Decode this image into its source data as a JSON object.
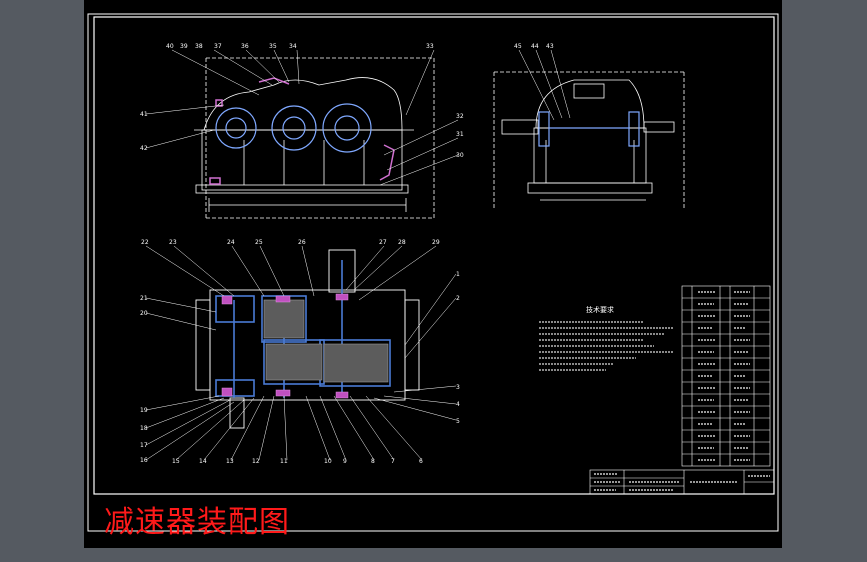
{
  "title": "减速器装配图",
  "tech_requirements_heading": "技术要求",
  "colors": {
    "background": "#000000",
    "outline": "#ffffff",
    "gear_section": "#4a7bd4",
    "bearing": "#d070d0",
    "hatch": "#a0a0ff",
    "shaft": "#7a7a7a",
    "caption": "#ff1a1a",
    "surround": "#555a61"
  },
  "callouts": {
    "top_view": [
      "40",
      "39",
      "38",
      "37",
      "36",
      "35",
      "34",
      "33",
      "41",
      "42",
      "32",
      "31",
      "30"
    ],
    "side_view": [
      "45",
      "44",
      "43"
    ],
    "plan_top": [
      "22",
      "23",
      "24",
      "25",
      "26",
      "27",
      "28",
      "29"
    ],
    "plan_left": [
      "21",
      "20",
      "19",
      "18",
      "17",
      "16"
    ],
    "plan_bottom": [
      "15",
      "14",
      "13",
      "12",
      "11",
      "10",
      "9",
      "8",
      "7",
      "6"
    ],
    "plan_right": [
      "1",
      "2",
      "3",
      "4",
      "5"
    ]
  }
}
